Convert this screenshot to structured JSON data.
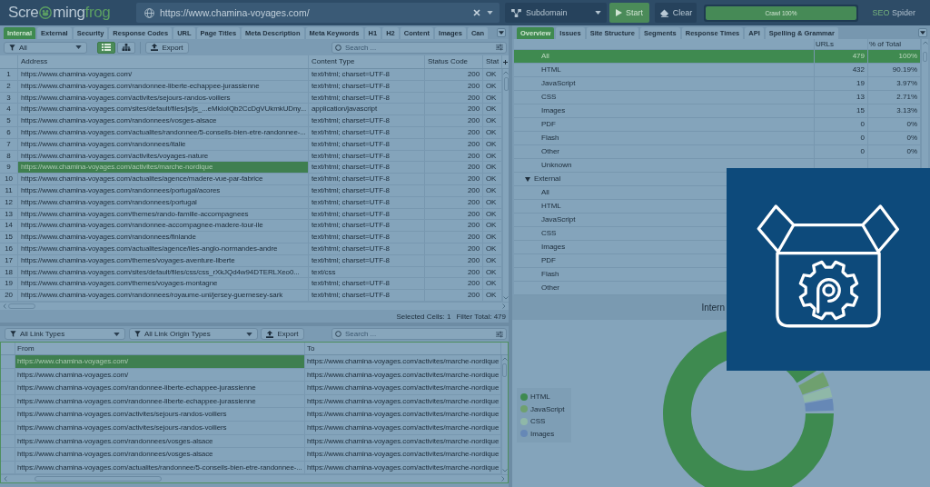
{
  "toolbar": {
    "logo": [
      "Scre",
      "ming",
      "frog"
    ],
    "url": "https://www.chamina-voyages.com/",
    "mode": "Subdomain",
    "start": "Start",
    "clear": "Clear",
    "progress": {
      "label": "Crawl 100%",
      "level": 1
    },
    "product": [
      "SEO",
      "Spider"
    ]
  },
  "left_tabs": [
    {
      "label": "Internal",
      "selected": true
    },
    {
      "label": "External",
      "selected": false
    },
    {
      "label": "Security",
      "selected": false
    },
    {
      "label": "Response Codes",
      "selected": false
    },
    {
      "label": "URL",
      "selected": false
    },
    {
      "label": "Page Titles",
      "selected": false
    },
    {
      "label": "Meta Description",
      "selected": false
    },
    {
      "label": "Meta Keywords",
      "selected": false
    },
    {
      "label": "H1",
      "selected": false
    },
    {
      "label": "H2",
      "selected": false
    },
    {
      "label": "Content",
      "selected": false
    },
    {
      "label": "Images",
      "selected": false
    },
    {
      "label": "Can",
      "selected": false
    }
  ],
  "main_table": {
    "filter": "All",
    "views": [
      {
        "kind": "list",
        "selected": true
      },
      {
        "kind": "tree",
        "selected": false
      }
    ],
    "export": "Export",
    "search": {
      "placeholder": "Search ..."
    },
    "columns": [
      "Address",
      "Content Type",
      "Status Code",
      "Stat"
    ],
    "rows": [
      {
        "number": "1",
        "address": "https://www.chamina-voyages.com/",
        "content_type": "text/html; charset=UTF-8",
        "status_code": "200",
        "status": "OK",
        "selected": false
      },
      {
        "number": "2",
        "address": "https://www.chamina-voyages.com/randonnee-liberte-echappee-jurassienne",
        "content_type": "text/html; charset=UTF-8",
        "status_code": "200",
        "status": "OK",
        "selected": false
      },
      {
        "number": "3",
        "address": "https://www.chamina-voyages.com/activites/sejours-randos-voiliers",
        "content_type": "text/html; charset=UTF-8",
        "status_code": "200",
        "status": "OK",
        "selected": false
      },
      {
        "number": "4",
        "address": "https://www.chamina-voyages.com/sites/default/files/js/js_...eMkIoIQb2CcDgVUkmkUDny...",
        "content_type": "application/javascript",
        "status_code": "200",
        "status": "OK",
        "selected": false
      },
      {
        "number": "5",
        "address": "https://www.chamina-voyages.com/randonnees/vosges-alsace",
        "content_type": "text/html; charset=UTF-8",
        "status_code": "200",
        "status": "OK",
        "selected": false
      },
      {
        "number": "6",
        "address": "https://www.chamina-voyages.com/actualites/randonnee/5-conseils-bien-etre-randonnee-...",
        "content_type": "text/html; charset=UTF-8",
        "status_code": "200",
        "status": "OK",
        "selected": false
      },
      {
        "number": "7",
        "address": "https://www.chamina-voyages.com/randonnees/italie",
        "content_type": "text/html; charset=UTF-8",
        "status_code": "200",
        "status": "OK",
        "selected": false
      },
      {
        "number": "8",
        "address": "https://www.chamina-voyages.com/activites/voyages-nature",
        "content_type": "text/html; charset=UTF-8",
        "status_code": "200",
        "status": "OK",
        "selected": false
      },
      {
        "number": "9",
        "address": "https://www.chamina-voyages.com/activites/marche-nordique",
        "content_type": "text/html; charset=UTF-8",
        "status_code": "200",
        "status": "OK",
        "selected": true
      },
      {
        "number": "10",
        "address": "https://www.chamina-voyages.com/actualites/agence/madere-vue-par-fabrice",
        "content_type": "text/html; charset=UTF-8",
        "status_code": "200",
        "status": "OK",
        "selected": false
      },
      {
        "number": "11",
        "address": "https://www.chamina-voyages.com/randonnees/portugal/acores",
        "content_type": "text/html; charset=UTF-8",
        "status_code": "200",
        "status": "OK",
        "selected": false
      },
      {
        "number": "12",
        "address": "https://www.chamina-voyages.com/randonnees/portugal",
        "content_type": "text/html; charset=UTF-8",
        "status_code": "200",
        "status": "OK",
        "selected": false
      },
      {
        "number": "13",
        "address": "https://www.chamina-voyages.com/themes/rando-famille-accompagnees",
        "content_type": "text/html; charset=UTF-8",
        "status_code": "200",
        "status": "OK",
        "selected": false
      },
      {
        "number": "14",
        "address": "https://www.chamina-voyages.com/randonnee-accompagnee-madere-tour-ile",
        "content_type": "text/html; charset=UTF-8",
        "status_code": "200",
        "status": "OK",
        "selected": false
      },
      {
        "number": "15",
        "address": "https://www.chamina-voyages.com/randonnees/finlande",
        "content_type": "text/html; charset=UTF-8",
        "status_code": "200",
        "status": "OK",
        "selected": false
      },
      {
        "number": "16",
        "address": "https://www.chamina-voyages.com/actualites/agence/iles-anglo-normandes-andre",
        "content_type": "text/html; charset=UTF-8",
        "status_code": "200",
        "status": "OK",
        "selected": false
      },
      {
        "number": "17",
        "address": "https://www.chamina-voyages.com/themes/voyages-aventure-liberte",
        "content_type": "text/html; charset=UTF-8",
        "status_code": "200",
        "status": "OK",
        "selected": false
      },
      {
        "number": "18",
        "address": "https://www.chamina-voyages.com/sites/default/files/css/css_rXkJQd4w94DTERLXeo0...",
        "content_type": "text/css",
        "status_code": "200",
        "status": "OK",
        "selected": false
      },
      {
        "number": "19",
        "address": "https://www.chamina-voyages.com/themes/voyages-montagne",
        "content_type": "text/html; charset=UTF-8",
        "status_code": "200",
        "status": "OK",
        "selected": false
      },
      {
        "number": "20",
        "address": "https://www.chamina-voyages.com/randonnees/royaume-uni/jersey-guernesey-sark",
        "content_type": "text/html; charset=UTF-8",
        "status_code": "200",
        "status": "OK",
        "selected": false
      }
    ]
  },
  "status_bar": [
    "Selected Cells: 1",
    "Filter Total: 479"
  ],
  "links_table": {
    "filters": [
      "All Link Types",
      "All Link Origin Types"
    ],
    "export": "Export",
    "search": {
      "placeholder": "Search ..."
    },
    "columns": [
      "From",
      "To"
    ],
    "rows": [
      {
        "from": "https://www.chamina-voyages.com/",
        "to": "https://www.chamina-voyages.com/activites/marche-nordique",
        "selected": true
      },
      {
        "from": "https://www.chamina-voyages.com/",
        "to": "https://www.chamina-voyages.com/activites/marche-nordique",
        "selected": false
      },
      {
        "from": "https://www.chamina-voyages.com/randonnee-liberte-echappee-jurassienne",
        "to": "https://www.chamina-voyages.com/activites/marche-nordique",
        "selected": false
      },
      {
        "from": "https://www.chamina-voyages.com/randonnee-liberte-echappee-jurassienne",
        "to": "https://www.chamina-voyages.com/activites/marche-nordique",
        "selected": false
      },
      {
        "from": "https://www.chamina-voyages.com/activites/sejours-randos-voiliers",
        "to": "https://www.chamina-voyages.com/activites/marche-nordique",
        "selected": false
      },
      {
        "from": "https://www.chamina-voyages.com/activites/sejours-randos-voiliers",
        "to": "https://www.chamina-voyages.com/activites/marche-nordique",
        "selected": false
      },
      {
        "from": "https://www.chamina-voyages.com/randonnees/vosges-alsace",
        "to": "https://www.chamina-voyages.com/activites/marche-nordique",
        "selected": false
      },
      {
        "from": "https://www.chamina-voyages.com/randonnees/vosges-alsace",
        "to": "https://www.chamina-voyages.com/activites/marche-nordique",
        "selected": false
      },
      {
        "from": "https://www.chamina-voyages.com/actualites/randonnee/5-conseils-bien-etre-randonnee-...",
        "to": "https://www.chamina-voyages.com/activites/marche-nordique",
        "selected": false
      }
    ]
  },
  "right_tabs": [
    {
      "label": "Overview",
      "selected": true
    },
    {
      "label": "Issues",
      "selected": false
    },
    {
      "label": "Site Structure",
      "selected": false
    },
    {
      "label": "Segments",
      "selected": false
    },
    {
      "label": "Response Times",
      "selected": false
    },
    {
      "label": "API",
      "selected": false
    },
    {
      "label": "Spelling & Grammar",
      "selected": false
    }
  ],
  "overview": {
    "columns": [
      "URLs",
      "% of Total"
    ],
    "groups": [
      {
        "children": [
          {
            "label": "All",
            "urls": "479",
            "percent": "100%",
            "selected": true
          },
          {
            "label": "HTML",
            "urls": "432",
            "percent": "90.19%",
            "selected": false
          },
          {
            "label": "JavaScript",
            "urls": "19",
            "percent": "3.97%",
            "selected": false
          },
          {
            "label": "CSS",
            "urls": "13",
            "percent": "2.71%",
            "selected": false
          },
          {
            "label": "Images",
            "urls": "15",
            "percent": "3.13%",
            "selected": false
          },
          {
            "label": "PDF",
            "urls": "0",
            "percent": "0%",
            "selected": false
          },
          {
            "label": "Flash",
            "urls": "0",
            "percent": "0%",
            "selected": false
          },
          {
            "label": "Other",
            "urls": "0",
            "percent": "0%",
            "selected": false
          },
          {
            "label": "Unknown",
            "selected": false
          }
        ]
      },
      {
        "label": "External",
        "expanded": true,
        "selected": false,
        "children": [
          {
            "label": "All",
            "selected": false
          },
          {
            "label": "HTML",
            "selected": false
          },
          {
            "label": "JavaScript",
            "selected": false
          },
          {
            "label": "CSS",
            "selected": false
          },
          {
            "label": "Images",
            "selected": false
          },
          {
            "label": "PDF",
            "selected": false
          },
          {
            "label": "Flash",
            "selected": false
          },
          {
            "label": "Other",
            "selected": false
          }
        ]
      }
    ]
  },
  "chart": {
    "title": "Intern",
    "legend": [
      {
        "label": "HTML",
        "color": "#3e8a50"
      },
      {
        "label": "JavaScript",
        "color": "#6fa06f"
      },
      {
        "label": "CSS",
        "color": "#8fb8a8"
      },
      {
        "label": "Images",
        "color": "#6688b6"
      }
    ]
  }
}
